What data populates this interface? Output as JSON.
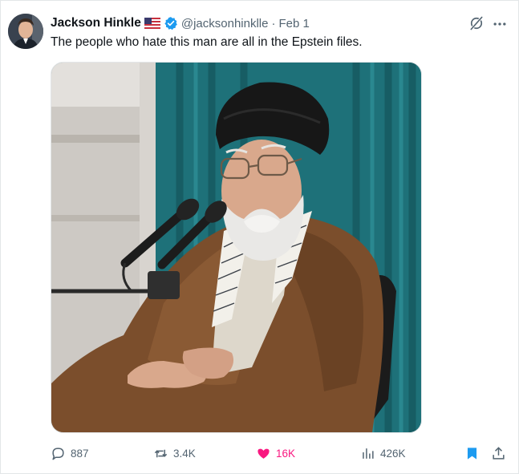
{
  "author": {
    "name": "Jackson Hinkle",
    "handle": "@jacksonhinklle",
    "separator": "·",
    "date": "Feb 1"
  },
  "tweet": {
    "text": "The people who hate this man are all in the Epstein files."
  },
  "actions": {
    "replies": "887",
    "reposts": "3.4K",
    "likes": "16K",
    "views": "426K"
  },
  "icons": [
    "us-flag-icon",
    "verified-badge-icon",
    "grok-icon",
    "more-icon",
    "reply-icon",
    "repost-icon",
    "like-icon",
    "views-icon",
    "bookmark-icon",
    "share-icon"
  ],
  "colors": {
    "text": "#0f1419",
    "secondary": "#536471",
    "verified": "#1d9bf0",
    "like": "#f91880",
    "bookmark": "#1d9bf0"
  }
}
